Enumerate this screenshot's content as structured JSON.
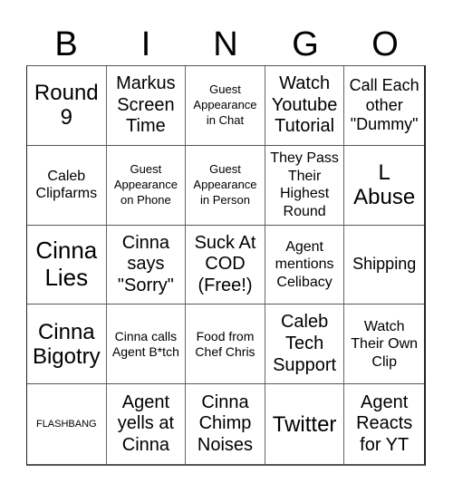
{
  "header": {
    "letters": [
      "B",
      "I",
      "N",
      "G",
      "O"
    ]
  },
  "board": {
    "rows": [
      [
        "Round 9",
        "Markus Screen Time",
        "Guest Appearance in Chat",
        "Watch Youtube Tutorial",
        "Call Each other \"Dummy\""
      ],
      [
        "Caleb Clipfarms",
        "Guest Appearance on Phone",
        "Guest Appearance in Person",
        "They Pass Their Highest Round",
        "L Abuse"
      ],
      [
        "Cinna Lies",
        "Cinna says \"Sorry\"",
        "Suck At COD (Free!)",
        "Agent mentions Celibacy",
        "Shipping"
      ],
      [
        "Cinna Bigotry",
        "Cinna calls Agent B*tch",
        "Food from Chef Chris",
        "Caleb Tech Support",
        "Watch Their Own Clip"
      ],
      [
        "FLASHBANG",
        "Agent yells at Cinna",
        "Cinna Chimp Noises",
        "Twitter",
        "Agent Reacts for YT"
      ]
    ]
  }
}
